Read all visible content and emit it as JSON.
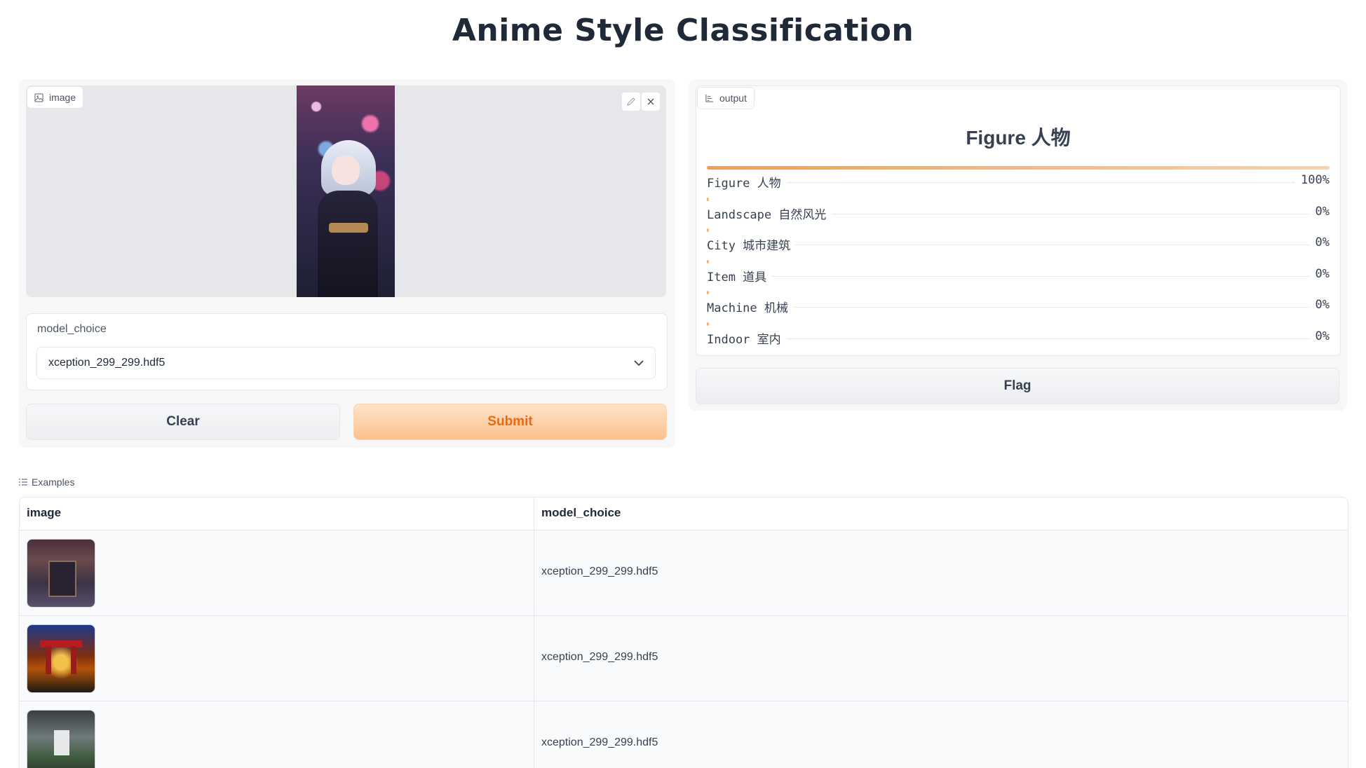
{
  "page": {
    "title": "Anime Style Classification"
  },
  "input": {
    "image_label": "image",
    "model_label": "model_choice",
    "model_value": "xception_299_299.hdf5",
    "clear_label": "Clear",
    "submit_label": "Submit"
  },
  "output": {
    "label": "output",
    "top_class": "Figure 人物",
    "confidences": [
      {
        "label": "Figure 人物",
        "value": "100%",
        "fraction": 1.0
      },
      {
        "label": "Landscape 自然风光",
        "value": "0%",
        "fraction": 0.0
      },
      {
        "label": "City 城市建筑",
        "value": "0%",
        "fraction": 0.0
      },
      {
        "label": "Item 道具",
        "value": "0%",
        "fraction": 0.0
      },
      {
        "label": "Machine 机械",
        "value": "0%",
        "fraction": 0.0
      },
      {
        "label": "Indoor 室内",
        "value": "0%",
        "fraction": 0.0
      }
    ],
    "flag_label": "Flag"
  },
  "examples": {
    "label": "Examples",
    "headers": [
      "image",
      "model_choice"
    ],
    "rows": [
      {
        "model_choice": "xception_299_299.hdf5"
      },
      {
        "model_choice": "xception_299_299.hdf5"
      },
      {
        "model_choice": "xception_299_299.hdf5"
      }
    ]
  },
  "colors": {
    "accent": "#f59e4b",
    "submit_text": "#ea6a12"
  },
  "icons": {
    "image_label_icon": "image-icon",
    "edit": "pencil-icon",
    "close": "close-icon",
    "dropdown": "chevron-down-icon",
    "output_label_icon": "bar-chart-icon",
    "examples_icon": "list-icon"
  }
}
